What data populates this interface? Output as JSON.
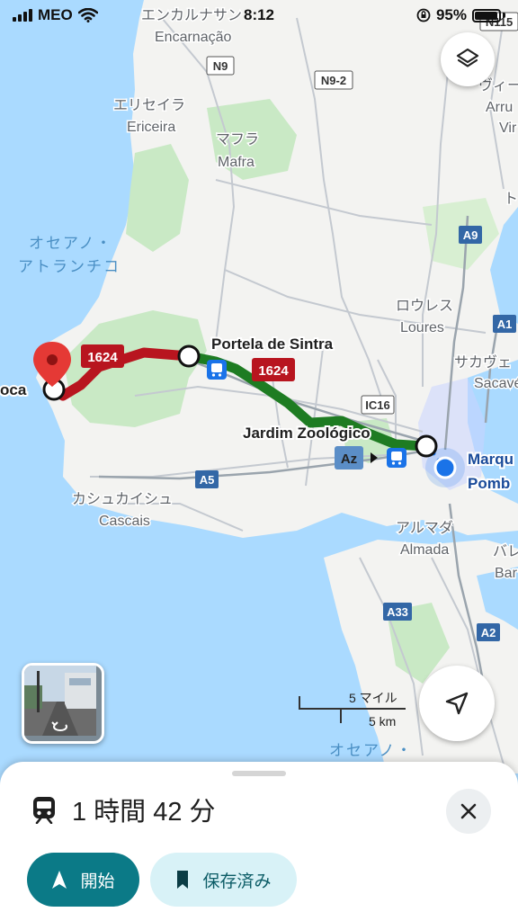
{
  "status_bar": {
    "carrier": "MEO",
    "time": "8:12",
    "battery": "95%"
  },
  "map": {
    "place_labels": {
      "encarnacao_jp": "エンカルナサン",
      "encarnacao": "Encarnação",
      "ericeira_jp": "エリセイラ",
      "ericeira": "Ericeira",
      "mafra_jp": "マフラ",
      "mafra": "Mafra",
      "ocean_jp_1": "オセアノ・",
      "ocean_jp_2": "アトランチコ",
      "loures_jp": "ロウレス",
      "loures": "Loures",
      "sacavem_jp": "サカヴェ",
      "sacavem": "Sacavé",
      "cascais_jp": "カシュカイシュ",
      "cascais": "Cascais",
      "almada_jp": "アルマダ",
      "almada": "Almada",
      "barreiro_jp": "バレ",
      "barreiro": "Bar",
      "vila_jp": "ヴィー",
      "arruda": "Arru",
      "vila": "Vir",
      "ocean_south_jp": "オセアノ・",
      "east_jp": "ト"
    },
    "road_labels": [
      "N115",
      "N9",
      "N9-2",
      "A9",
      "A1",
      "IC16",
      "A5",
      "A33",
      "A2"
    ],
    "route_labels": {
      "cabo_da_roca": "oca",
      "portela_de_sintra": "Portela de Sintra",
      "jardim_zoologico": "Jardim Zoológico",
      "marques_1": "Marqu",
      "marques_2": "Pomb"
    },
    "bus_number": "1624",
    "metro_line": "Az",
    "scale_imperial": "5 マイル",
    "scale_metric": "5 km",
    "colors": {
      "bus_route": "#b8151f",
      "metro_route": "#1e7c22",
      "water": "#aadaff",
      "land": "#f3f3f1",
      "park": "#c9e9c5",
      "my_location": "#1a73e8"
    },
    "icons": {
      "layers": "layers-icon",
      "locate": "navigation-arrow-icon",
      "destination": "red-pin-icon",
      "train": "train-icon"
    }
  },
  "sheet": {
    "duration": "1 時間 42 分",
    "start_label": "開始",
    "saved_label": "保存済み"
  }
}
